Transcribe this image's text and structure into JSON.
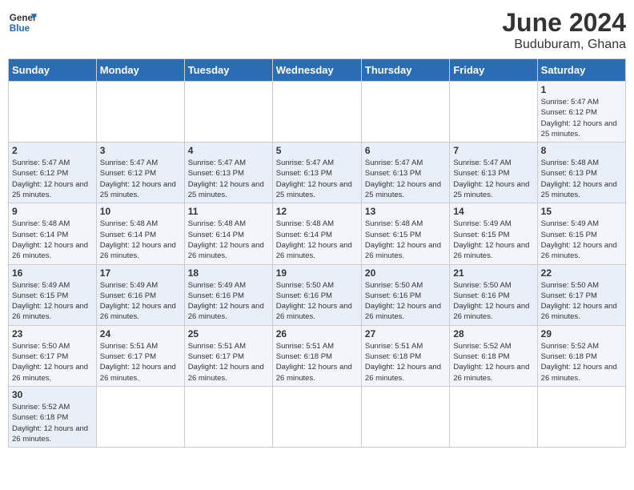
{
  "header": {
    "logo_general": "General",
    "logo_blue": "Blue",
    "month": "June 2024",
    "location": "Buduburam, Ghana"
  },
  "days_of_week": [
    "Sunday",
    "Monday",
    "Tuesday",
    "Wednesday",
    "Thursday",
    "Friday",
    "Saturday"
  ],
  "weeks": [
    [
      {
        "day": "",
        "sunrise": "",
        "sunset": "",
        "daylight": ""
      },
      {
        "day": "",
        "sunrise": "",
        "sunset": "",
        "daylight": ""
      },
      {
        "day": "",
        "sunrise": "",
        "sunset": "",
        "daylight": ""
      },
      {
        "day": "",
        "sunrise": "",
        "sunset": "",
        "daylight": ""
      },
      {
        "day": "",
        "sunrise": "",
        "sunset": "",
        "daylight": ""
      },
      {
        "day": "",
        "sunrise": "",
        "sunset": "",
        "daylight": ""
      },
      {
        "day": "1",
        "sunrise": "5:47 AM",
        "sunset": "6:12 PM",
        "daylight": "12 hours and 25 minutes."
      }
    ],
    [
      {
        "day": "2",
        "sunrise": "5:47 AM",
        "sunset": "6:12 PM",
        "daylight": "12 hours and 25 minutes."
      },
      {
        "day": "3",
        "sunrise": "5:47 AM",
        "sunset": "6:12 PM",
        "daylight": "12 hours and 25 minutes."
      },
      {
        "day": "4",
        "sunrise": "5:47 AM",
        "sunset": "6:13 PM",
        "daylight": "12 hours and 25 minutes."
      },
      {
        "day": "5",
        "sunrise": "5:47 AM",
        "sunset": "6:13 PM",
        "daylight": "12 hours and 25 minutes."
      },
      {
        "day": "6",
        "sunrise": "5:47 AM",
        "sunset": "6:13 PM",
        "daylight": "12 hours and 25 minutes."
      },
      {
        "day": "7",
        "sunrise": "5:47 AM",
        "sunset": "6:13 PM",
        "daylight": "12 hours and 25 minutes."
      },
      {
        "day": "8",
        "sunrise": "5:48 AM",
        "sunset": "6:13 PM",
        "daylight": "12 hours and 25 minutes."
      }
    ],
    [
      {
        "day": "9",
        "sunrise": "5:48 AM",
        "sunset": "6:14 PM",
        "daylight": "12 hours and 26 minutes."
      },
      {
        "day": "10",
        "sunrise": "5:48 AM",
        "sunset": "6:14 PM",
        "daylight": "12 hours and 26 minutes."
      },
      {
        "day": "11",
        "sunrise": "5:48 AM",
        "sunset": "6:14 PM",
        "daylight": "12 hours and 26 minutes."
      },
      {
        "day": "12",
        "sunrise": "5:48 AM",
        "sunset": "6:14 PM",
        "daylight": "12 hours and 26 minutes."
      },
      {
        "day": "13",
        "sunrise": "5:48 AM",
        "sunset": "6:15 PM",
        "daylight": "12 hours and 26 minutes."
      },
      {
        "day": "14",
        "sunrise": "5:49 AM",
        "sunset": "6:15 PM",
        "daylight": "12 hours and 26 minutes."
      },
      {
        "day": "15",
        "sunrise": "5:49 AM",
        "sunset": "6:15 PM",
        "daylight": "12 hours and 26 minutes."
      }
    ],
    [
      {
        "day": "16",
        "sunrise": "5:49 AM",
        "sunset": "6:15 PM",
        "daylight": "12 hours and 26 minutes."
      },
      {
        "day": "17",
        "sunrise": "5:49 AM",
        "sunset": "6:16 PM",
        "daylight": "12 hours and 26 minutes."
      },
      {
        "day": "18",
        "sunrise": "5:49 AM",
        "sunset": "6:16 PM",
        "daylight": "12 hours and 26 minutes."
      },
      {
        "day": "19",
        "sunrise": "5:50 AM",
        "sunset": "6:16 PM",
        "daylight": "12 hours and 26 minutes."
      },
      {
        "day": "20",
        "sunrise": "5:50 AM",
        "sunset": "6:16 PM",
        "daylight": "12 hours and 26 minutes."
      },
      {
        "day": "21",
        "sunrise": "5:50 AM",
        "sunset": "6:16 PM",
        "daylight": "12 hours and 26 minutes."
      },
      {
        "day": "22",
        "sunrise": "5:50 AM",
        "sunset": "6:17 PM",
        "daylight": "12 hours and 26 minutes."
      }
    ],
    [
      {
        "day": "23",
        "sunrise": "5:50 AM",
        "sunset": "6:17 PM",
        "daylight": "12 hours and 26 minutes."
      },
      {
        "day": "24",
        "sunrise": "5:51 AM",
        "sunset": "6:17 PM",
        "daylight": "12 hours and 26 minutes."
      },
      {
        "day": "25",
        "sunrise": "5:51 AM",
        "sunset": "6:17 PM",
        "daylight": "12 hours and 26 minutes."
      },
      {
        "day": "26",
        "sunrise": "5:51 AM",
        "sunset": "6:18 PM",
        "daylight": "12 hours and 26 minutes."
      },
      {
        "day": "27",
        "sunrise": "5:51 AM",
        "sunset": "6:18 PM",
        "daylight": "12 hours and 26 minutes."
      },
      {
        "day": "28",
        "sunrise": "5:52 AM",
        "sunset": "6:18 PM",
        "daylight": "12 hours and 26 minutes."
      },
      {
        "day": "29",
        "sunrise": "5:52 AM",
        "sunset": "6:18 PM",
        "daylight": "12 hours and 26 minutes."
      }
    ],
    [
      {
        "day": "30",
        "sunrise": "5:52 AM",
        "sunset": "6:18 PM",
        "daylight": "12 hours and 26 minutes."
      },
      {
        "day": "",
        "sunrise": "",
        "sunset": "",
        "daylight": ""
      },
      {
        "day": "",
        "sunrise": "",
        "sunset": "",
        "daylight": ""
      },
      {
        "day": "",
        "sunrise": "",
        "sunset": "",
        "daylight": ""
      },
      {
        "day": "",
        "sunrise": "",
        "sunset": "",
        "daylight": ""
      },
      {
        "day": "",
        "sunrise": "",
        "sunset": "",
        "daylight": ""
      },
      {
        "day": "",
        "sunrise": "",
        "sunset": "",
        "daylight": ""
      }
    ]
  ]
}
